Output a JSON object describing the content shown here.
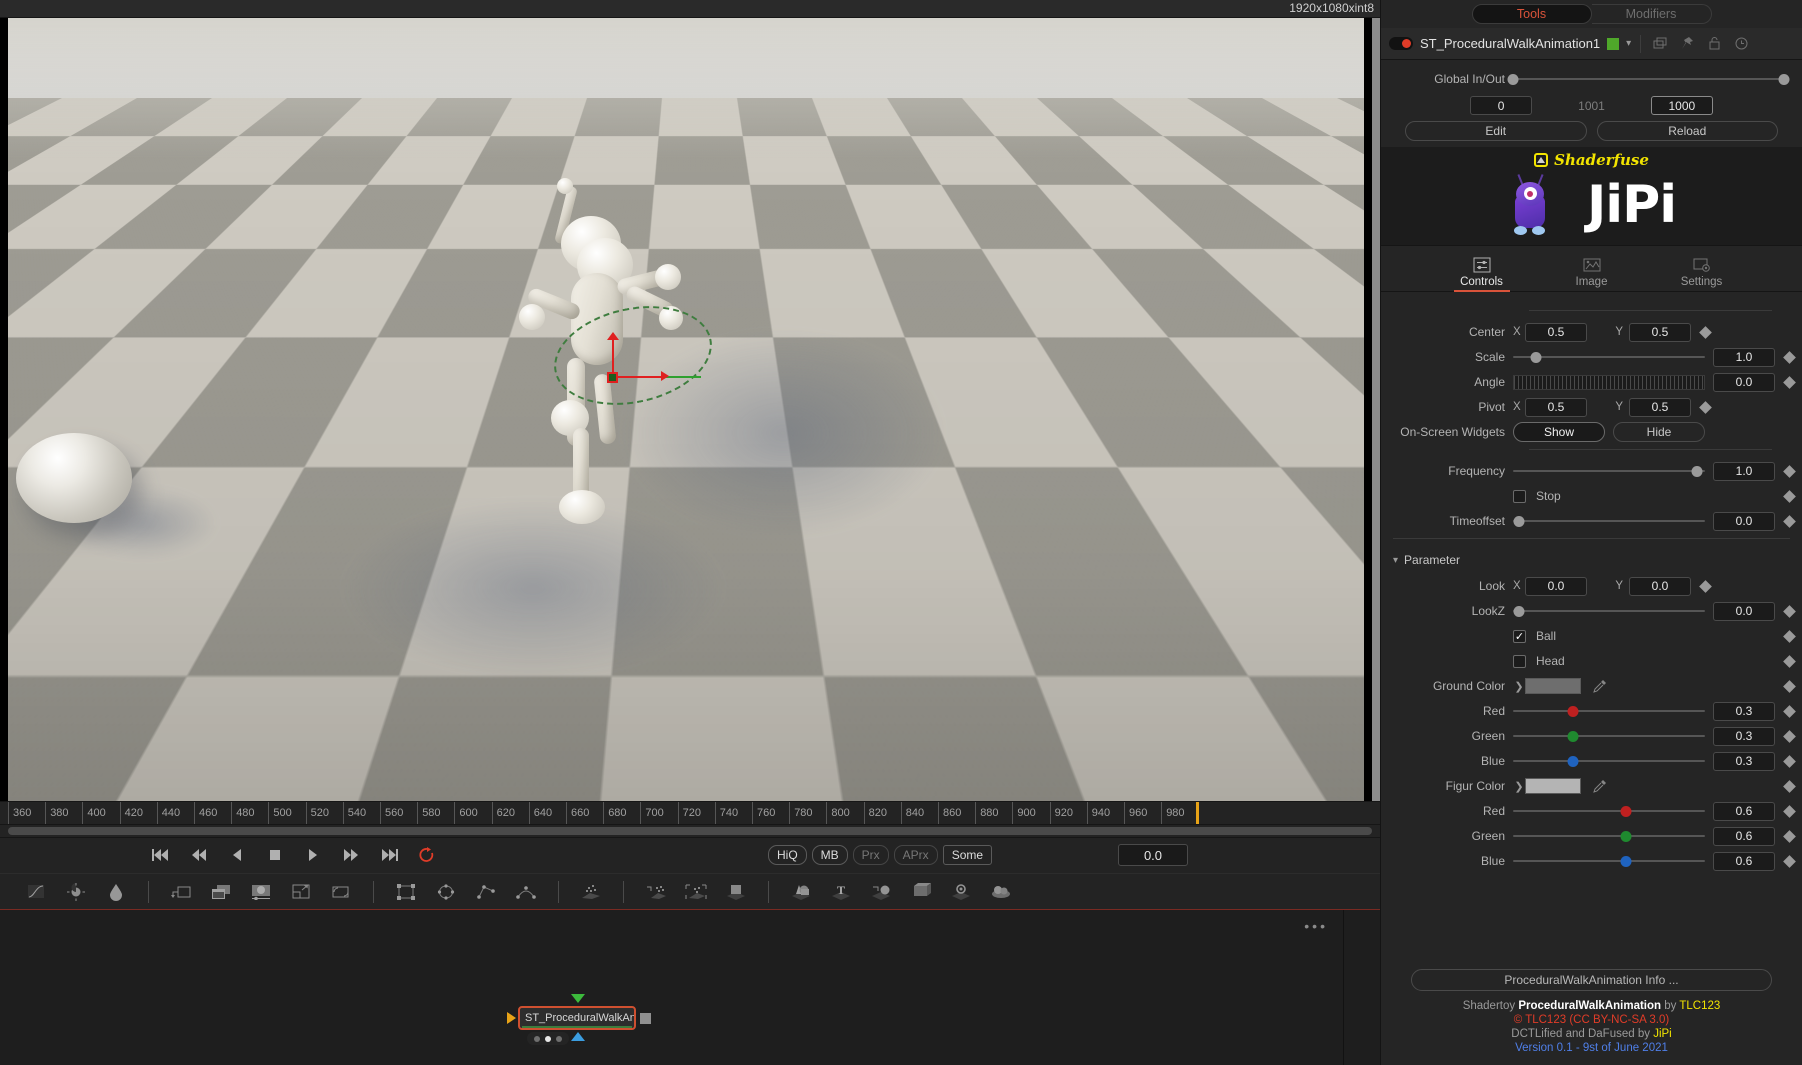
{
  "viewer": {
    "resolution": "1920x1080xint8"
  },
  "timeline": {
    "ticks": [
      "360",
      "380",
      "400",
      "420",
      "440",
      "460",
      "480",
      "500",
      "520",
      "540",
      "560",
      "580",
      "600",
      "620",
      "640",
      "660",
      "680",
      "700",
      "720",
      "740",
      "760",
      "780",
      "800",
      "820",
      "840",
      "860",
      "880",
      "900",
      "920",
      "940",
      "960",
      "980"
    ],
    "current_time": "0.0"
  },
  "transport": {
    "buttons": [
      "skip-to-start",
      "rewind",
      "step-back",
      "stop",
      "play",
      "fast-forward",
      "skip-to-end",
      "loop"
    ]
  },
  "quality": {
    "items": [
      {
        "label": "HiQ",
        "active": true
      },
      {
        "label": "MB",
        "active": true
      },
      {
        "label": "Prx",
        "active": false
      },
      {
        "label": "APrx",
        "active": false
      },
      {
        "label": "Some",
        "active": true
      }
    ]
  },
  "toolbar": {
    "icons": [
      "color-curves-icon",
      "brightness-contrast-icon",
      "blur-icon",
      "transform-icon",
      "merge-icon",
      "background-icon",
      "resize-icon",
      "loop-transform-icon",
      "rectangle-mask-icon",
      "ellipse-mask-icon",
      "polygon-mask-icon",
      "bspline-mask-icon",
      "paint-mask-icon",
      "particle-emitter-icon",
      "particle-bounce-icon",
      "particle-render-icon",
      "image-plane-icon",
      "shape-3d-icon",
      "text-3d-icon",
      "merge-3d-icon",
      "renderer-3d-icon",
      "camera-3d-icon"
    ]
  },
  "nodegraph": {
    "node_label": "ST_ProceduralWalkAn...",
    "overflow_menu": "•••"
  },
  "panel": {
    "top_tabs": [
      {
        "label": "Tools",
        "active": true
      },
      {
        "label": "Modifiers",
        "active": false
      }
    ],
    "tool_header": {
      "title": "ST_ProceduralWalkAnimation1",
      "color_chip": "#4fa82a",
      "icons": [
        "copy-icon",
        "pin-icon",
        "lock-icon",
        "reset-icon"
      ]
    },
    "global_inout": {
      "label": "Global In/Out",
      "in_value": "0",
      "range_value": "1001",
      "out_value": "1000"
    },
    "actions": {
      "edit": "Edit",
      "reload": "Reload"
    },
    "branding": {
      "shaderfuse": "Shaderfuse",
      "product": "JiPi"
    },
    "mid_tabs": [
      {
        "label": "Controls",
        "active": true,
        "icon": "sliders-icon"
      },
      {
        "label": "Image",
        "active": false,
        "icon": "image-icon"
      },
      {
        "label": "Settings",
        "active": false,
        "icon": "settings-icon"
      }
    ],
    "controls": {
      "center": {
        "label": "Center",
        "x_label": "X",
        "y_label": "Y",
        "x": "0.5",
        "y": "0.5"
      },
      "scale": {
        "label": "Scale",
        "value": "1.0",
        "pct": 12
      },
      "angle": {
        "label": "Angle",
        "value": "0.0"
      },
      "pivot": {
        "label": "Pivot",
        "x_label": "X",
        "y_label": "Y",
        "x": "0.5",
        "y": "0.5"
      },
      "widgets": {
        "label": "On-Screen Widgets",
        "show": "Show",
        "hide": "Hide",
        "selected": "Show"
      },
      "frequency": {
        "label": "Frequency",
        "value": "1.0",
        "pct": 96
      },
      "stop": {
        "label": "Stop",
        "checked": false
      },
      "timeoffset": {
        "label": "Timeoffset",
        "value": "0.0",
        "pct": 3
      }
    },
    "parameter": {
      "group_label": "Parameter",
      "look": {
        "label": "Look",
        "x_label": "X",
        "y_label": "Y",
        "x": "0.0",
        "y": "0.0"
      },
      "lookz": {
        "label": "LookZ",
        "value": "0.0",
        "pct": 3
      },
      "ball": {
        "label": "Ball",
        "checked": true
      },
      "head": {
        "label": "Head",
        "checked": false
      },
      "ground_color": {
        "label": "Ground Color",
        "swatch": "#6e6e6e",
        "red": {
          "label": "Red",
          "value": "0.3",
          "pct": 31
        },
        "green": {
          "label": "Green",
          "value": "0.3",
          "pct": 31
        },
        "blue": {
          "label": "Blue",
          "value": "0.3",
          "pct": 31
        }
      },
      "figur_color": {
        "label": "Figur Color",
        "swatch": "#b4b4b4",
        "red": {
          "label": "Red",
          "value": "0.6",
          "pct": 59
        },
        "green": {
          "label": "Green",
          "value": "0.6",
          "pct": 59
        },
        "blue": {
          "label": "Blue",
          "value": "0.6",
          "pct": 59
        }
      }
    },
    "footer": {
      "info_button": "ProceduralWalkAnimation Info ...",
      "line1_pre": "Shadertoy ",
      "line1_name": "ProceduralWalkAnimation",
      "line1_mid": " by ",
      "line1_author": "TLC123",
      "line2": "© TLC123 (CC BY-NC-SA 3.0)",
      "line3_pre": "DCTLified and DaFused by ",
      "line3_author": "JiPi",
      "line4": "Version 0.1 - 9st of June 2021"
    }
  }
}
